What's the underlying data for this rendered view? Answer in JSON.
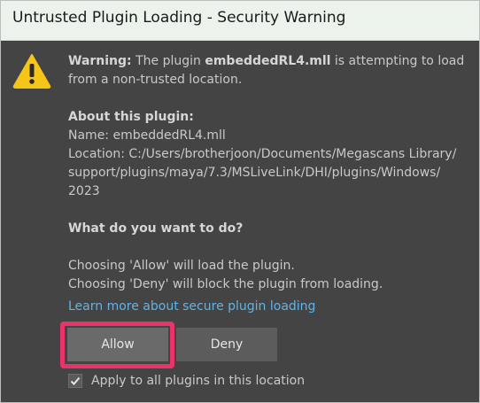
{
  "window": {
    "title": "Untrusted Plugin Loading - Security Warning"
  },
  "icons": {
    "warning": "warning-icon",
    "checkmark": "checkmark-icon"
  },
  "message": {
    "warning_label": "Warning:",
    "warning_prefix": " The plugin ",
    "plugin_file": "embeddedRL4.mll",
    "warning_suffix": " is attempting to load",
    "warning_line2": "from a non-trusted location."
  },
  "about": {
    "heading": "About this plugin:",
    "name_line": "Name: embeddedRL4.mll",
    "location_line1": "Location: C:/Users/brotherjoon/Documents/Megascans Library/",
    "location_line2": "support/plugins/maya/7.3/MSLiveLink/DHI/plugins/Windows/",
    "location_line3": "2023"
  },
  "question": {
    "heading": "What do you want to do?"
  },
  "explanation": {
    "allow_line": "Choosing 'Allow' will load the plugin.",
    "deny_line": "Choosing 'Deny' will block the plugin from loading."
  },
  "link": {
    "text": "Learn more about secure plugin loading"
  },
  "buttons": {
    "allow": "Allow",
    "deny": "Deny"
  },
  "checkbox": {
    "label": "Apply to all plugins in this location",
    "checked": true
  },
  "colors": {
    "dialog_bg": "#444444",
    "titlebar_bg": "#ebf3ec",
    "link": "#5fb4e8",
    "highlight": "#e8336b",
    "warning_yellow": "#f5c518"
  }
}
